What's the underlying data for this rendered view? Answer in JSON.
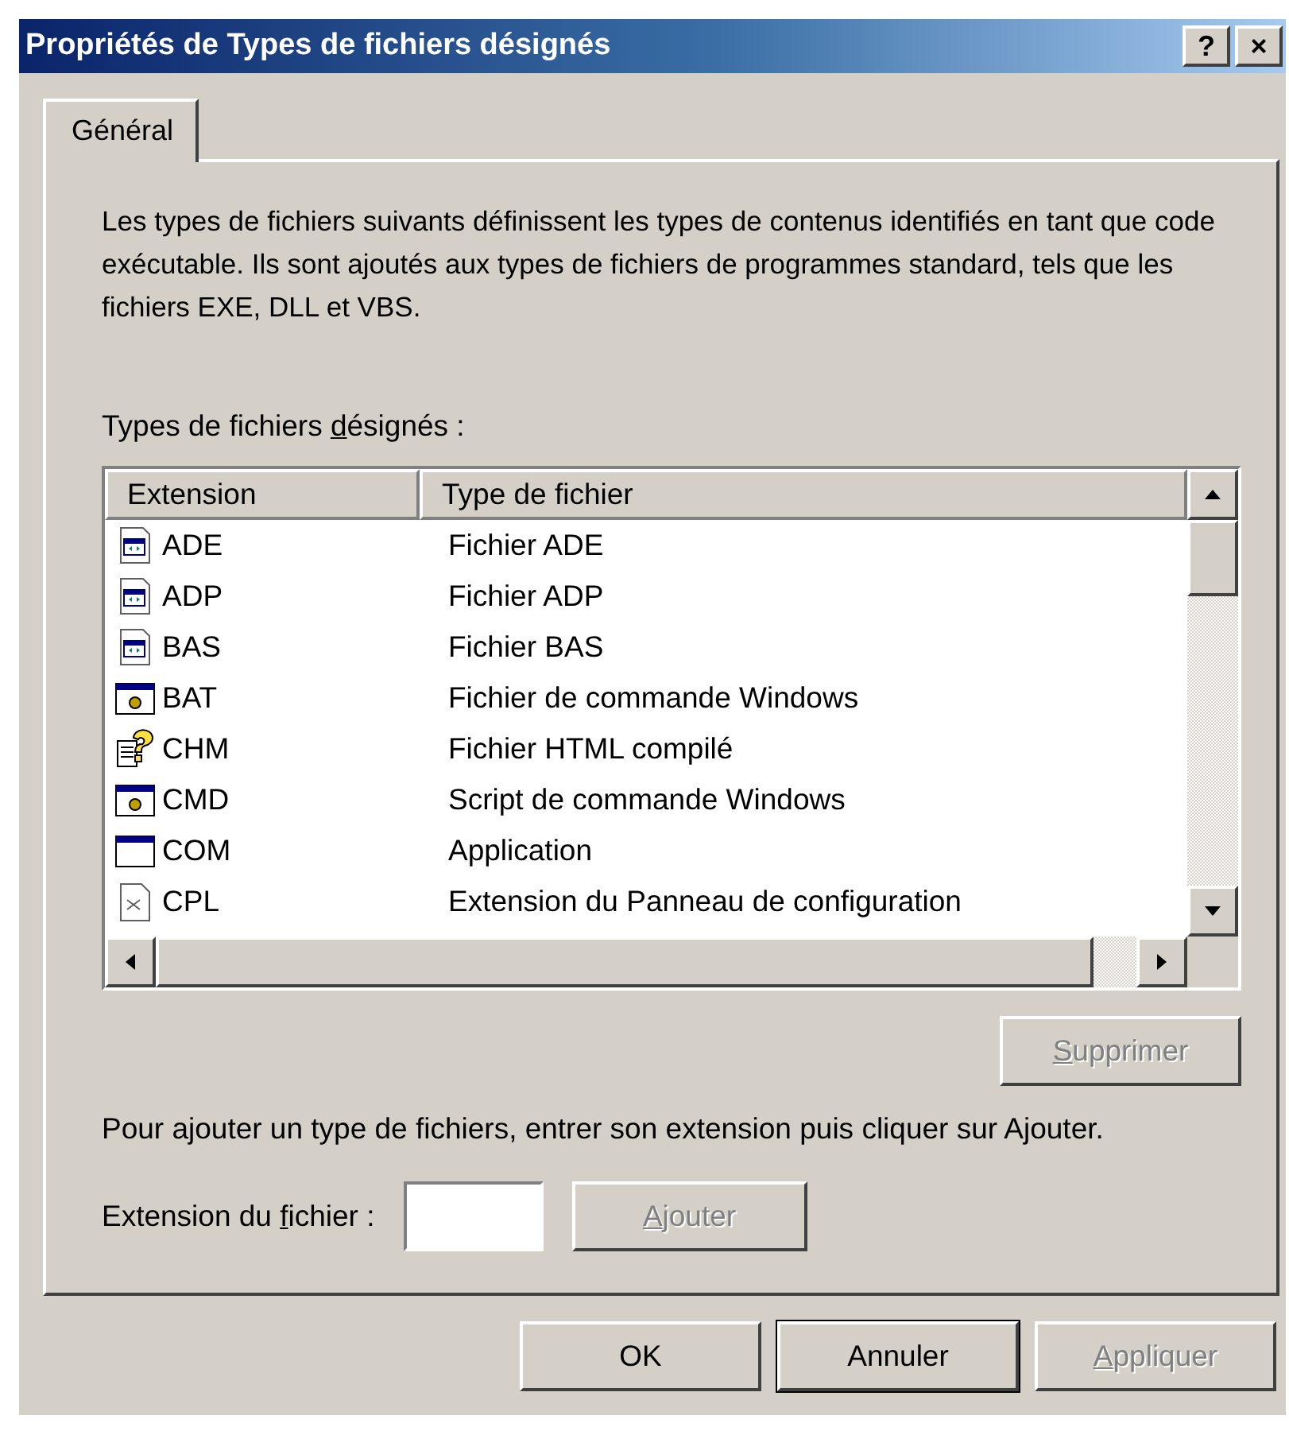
{
  "window": {
    "title": "Propriétés de Types de fichiers désignés",
    "title_buttons": [
      "?",
      "×"
    ]
  },
  "tabs": [
    {
      "label": "Général",
      "selected": true
    }
  ],
  "description": "Les types de fichiers suivants définissent les types de contenus identifiés en tant que code exécutable. Ils sont ajoutés aux types de fichiers de programmes standard, tels que les fichiers EXE, DLL et VBS.",
  "list_label": [
    {
      "text": "Types de fichiers ",
      "underlined": false
    },
    {
      "text": "d",
      "underlined": true
    },
    {
      "text": "ésignés :",
      "underlined": false
    }
  ],
  "table": {
    "columns": [
      "Extension",
      "Type de fichier"
    ],
    "rows": [
      {
        "kind": "module",
        "extension": "ADE",
        "type": "Fichier ADE"
      },
      {
        "kind": "module",
        "extension": "ADP",
        "type": "Fichier ADP"
      },
      {
        "kind": "module",
        "extension": "BAS",
        "type": "Fichier BAS"
      },
      {
        "kind": "batch",
        "extension": "BAT",
        "type": "Fichier de commande Windows"
      },
      {
        "kind": "help",
        "extension": "CHM",
        "type": "Fichier HTML compilé"
      },
      {
        "kind": "batch",
        "extension": "CMD",
        "type": "Script de commande Windows"
      },
      {
        "kind": "program",
        "extension": "COM",
        "type": "Application"
      },
      {
        "kind": "document",
        "extension": "CPL",
        "type": "Extension du Panneau de configuration"
      }
    ]
  },
  "remove_button": {
    "label": [
      {
        "text": "S",
        "underlined": true
      },
      {
        "text": "upprimer",
        "underlined": false
      }
    ],
    "disabled": true
  },
  "add_hint": "Pour ajouter un type de fichiers, entrer son extension puis cliquer sur Ajouter.",
  "extension_field": {
    "label": [
      {
        "text": "Extension du ",
        "underlined": false
      },
      {
        "text": "f",
        "underlined": true
      },
      {
        "text": "ichier :",
        "underlined": false
      }
    ]
  },
  "add_button": {
    "label": [
      {
        "text": "A",
        "underlined": true
      },
      {
        "text": "jouter",
        "underlined": false
      }
    ],
    "disabled": true
  },
  "buttons": [
    {
      "label": [
        {
          "text": "OK",
          "underlined": false
        }
      ],
      "disabled": false,
      "default": false
    },
    {
      "label": [
        {
          "text": "Annuler",
          "underlined": false
        }
      ],
      "disabled": false,
      "default": true
    },
    {
      "label": [
        {
          "text": "A",
          "underlined": true
        },
        {
          "text": "ppliquer",
          "underlined": false
        }
      ],
      "disabled": true,
      "default": false
    }
  ]
}
